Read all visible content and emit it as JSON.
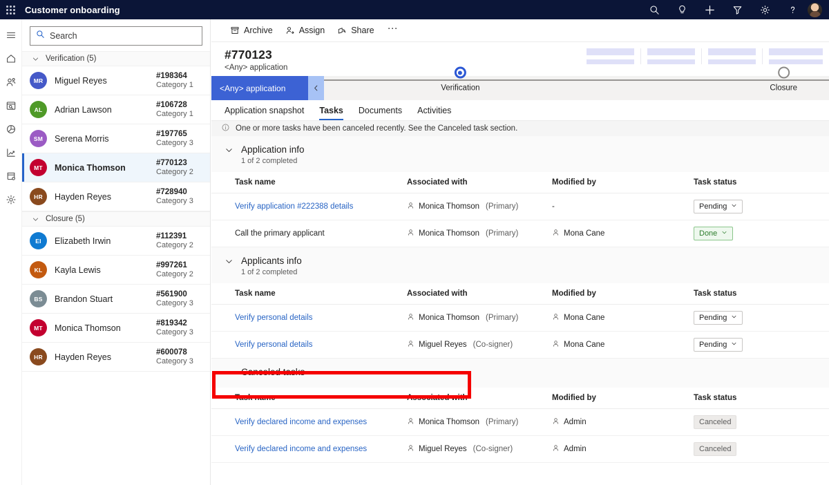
{
  "topbar": {
    "waffle_label": "App launcher",
    "app_title": "Customer onboarding",
    "icons": [
      "search-icon",
      "lightbulb-icon",
      "add-icon",
      "filter-icon",
      "settings-icon",
      "help-icon",
      "user-avatar"
    ]
  },
  "rail": {
    "items": [
      {
        "name": "hamburger-menu-icon"
      },
      {
        "name": "home-icon"
      },
      {
        "name": "contacts-icon"
      },
      {
        "name": "board-icon"
      },
      {
        "name": "pie-chart-icon"
      },
      {
        "name": "line-chart-icon"
      },
      {
        "name": "database-icon"
      },
      {
        "name": "settings-gear-icon"
      }
    ]
  },
  "sidebar": {
    "search": {
      "value": "",
      "placeholder": "Search"
    },
    "groups": [
      {
        "label": "Verification (5)",
        "items": [
          {
            "initials": "MR",
            "name": "Miguel Reyes",
            "id": "#198364",
            "category": "Category 1",
            "color": "#4559c8",
            "selected": false
          },
          {
            "initials": "AL",
            "name": "Adrian Lawson",
            "id": "#106728",
            "category": "Category 1",
            "color": "#4f9a28",
            "selected": false
          },
          {
            "initials": "SM",
            "name": "Serena Morris",
            "id": "#197765",
            "category": "Category 3",
            "color": "#9b5bc4",
            "selected": false
          },
          {
            "initials": "MT",
            "name": "Monica Thomson",
            "id": "#770123",
            "category": "Category 2",
            "color": "#c3002f",
            "selected": true
          },
          {
            "initials": "HR",
            "name": "Hayden Reyes",
            "id": "#728940",
            "category": "Category 3",
            "color": "#8a4a1e",
            "selected": false
          }
        ]
      },
      {
        "label": "Closure (5)",
        "items": [
          {
            "initials": "EI",
            "name": "Elizabeth Irwin",
            "id": "#112391",
            "category": "Category 2",
            "color": "#0f7ad1",
            "selected": false
          },
          {
            "initials": "KL",
            "name": "Kayla Lewis",
            "id": "#997261",
            "category": "Category 2",
            "color": "#c35a10",
            "selected": false
          },
          {
            "initials": "BS",
            "name": "Brandon Stuart",
            "id": "#561900",
            "category": "Category 3",
            "color": "#7b8c94",
            "selected": false
          },
          {
            "initials": "MT",
            "name": "Monica Thomson",
            "id": "#819342",
            "category": "Category 3",
            "color": "#c3002f",
            "selected": false
          },
          {
            "initials": "HR",
            "name": "Hayden Reyes",
            "id": "#600078",
            "category": "Category 3",
            "color": "#8a4a1e",
            "selected": false
          }
        ]
      }
    ]
  },
  "commandbar": {
    "archive": "Archive",
    "assign": "Assign",
    "share": "Share",
    "more": "···"
  },
  "record": {
    "id": "#770123",
    "subtitle": "<Any> application"
  },
  "stage": {
    "chip_label": "<Any> application",
    "collapse_icon": "chevron-left-icon",
    "nodes": [
      {
        "label": "Verification",
        "state": "active",
        "position_pct": 27
      },
      {
        "label": "Closure",
        "state": "idle",
        "position_pct": 91
      }
    ]
  },
  "tabs": [
    {
      "label": "Application snapshot",
      "active": false
    },
    {
      "label": "Tasks",
      "active": true
    },
    {
      "label": "Documents",
      "active": false
    },
    {
      "label": "Activities",
      "active": false
    }
  ],
  "notification": {
    "icon": "info-icon",
    "text": "One or more tasks have been canceled recently. See the Canceled task section."
  },
  "columns": [
    "Task name",
    "Associated with",
    "Modified by",
    "Task status"
  ],
  "sections": [
    {
      "title": "Application info",
      "count": "1 of 2 completed",
      "rows": [
        {
          "task": "Verify application #222388 details",
          "task_is_link": true,
          "associated": "Monica Thomson",
          "role": "(Primary)",
          "modified_by": "-",
          "modified_has_icon": false,
          "status": "Pending",
          "status_kind": "pending"
        },
        {
          "task": "Call the primary applicant",
          "task_is_link": false,
          "associated": "Monica Thomson",
          "role": "(Primary)",
          "modified_by": "Mona Cane",
          "modified_has_icon": true,
          "status": "Done",
          "status_kind": "done"
        }
      ]
    },
    {
      "title": "Applicants info",
      "count": "1 of 2 completed",
      "rows": [
        {
          "task": "Verify personal details",
          "task_is_link": true,
          "associated": "Monica Thomson",
          "role": "(Primary)",
          "modified_by": "Mona Cane",
          "modified_has_icon": true,
          "status": "Pending",
          "status_kind": "pending"
        },
        {
          "task": "Verify personal details",
          "task_is_link": true,
          "associated": "Miguel Reyes",
          "role": "(Co-signer)",
          "modified_by": "Mona Cane",
          "modified_has_icon": true,
          "status": "Pending",
          "status_kind": "pending"
        }
      ]
    },
    {
      "title": "Canceled tasks",
      "count": "",
      "highlighted": true,
      "rows": [
        {
          "task": "Verify declared income and expenses",
          "task_is_link": true,
          "associated": "Monica Thomson",
          "role": "(Primary)",
          "modified_by": "Admin",
          "modified_has_icon": true,
          "status": "Canceled",
          "status_kind": "canceled"
        },
        {
          "task": "Verify declared income and expenses",
          "task_is_link": true,
          "associated": "Miguel Reyes",
          "role": "(Co-signer)",
          "modified_by": "Admin",
          "modified_has_icon": true,
          "status": "Canceled",
          "status_kind": "canceled"
        }
      ]
    }
  ],
  "colors": {
    "topbar_bg": "#0b1537",
    "accent_blue": "#2563c9",
    "stage_chip": "#3c62d4",
    "link": "#2864c4",
    "annotation_red": "#f50000",
    "done_green": "#2d7d2d"
  }
}
